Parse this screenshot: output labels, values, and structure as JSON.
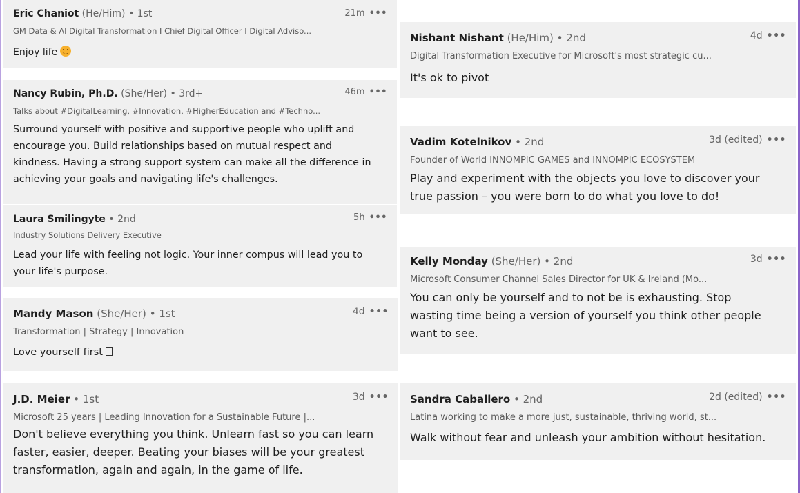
{
  "left": [
    {
      "name": "Eric Chaniot",
      "pron": "(He/Him)",
      "deg": "• 1st",
      "tagline": "GM Data & AI Digital Transformation I Chief Digital Officer I Digital Adviso...",
      "time": "21m",
      "message": "Enjoy life",
      "emoji": "smiling-face-icon"
    },
    {
      "name": "Nancy Rubin, Ph.D.",
      "pron": "(She/Her)",
      "deg": "• 3rd+",
      "tagline": "Talks about #DigitalLearning, #Innovation, #HigherEducation and #Techno...",
      "time": "46m",
      "message": [
        "Surround yourself with positive and supportive people who uplift and",
        "encourage you. Build relationships based on mutual respect and",
        "kindness. Having a strong support system can make all the difference in",
        "achieving your goals and navigating life's challenges."
      ]
    },
    {
      "name": "Laura Smilingyte",
      "pron": "",
      "deg": "• 2nd",
      "tagline": "Industry Solutions Delivery Executive",
      "time": "5h",
      "message": [
        "Lead your life with feeling not logic. Your inner compus will lead you to",
        "your life's purpose."
      ]
    },
    {
      "name": "Mandy Mason",
      "pron": "(She/Her)",
      "deg": "• 1st",
      "tagline": "Transformation | Strategy | Innovation",
      "time": "4d",
      "message": "Love yourself first"
    },
    {
      "name": "J.D. Meier",
      "pron": "",
      "deg": "• 1st",
      "tagline": "Microsoft 25 years | Leading Innovation for a Sustainable Future |...",
      "time": "3d",
      "message": [
        "Don't believe everything you think. Unlearn fast so you can learn",
        "faster, easier, deeper. Beating your biases will be your greatest",
        "transformation, again and again, in the game of life."
      ]
    }
  ],
  "right": [
    {
      "name": "Nishant Nishant",
      "pron": "(He/Him)",
      "deg": "• 2nd",
      "tagline": "Digital Transformation Executive for Microsoft's most strategic cu...",
      "time": "4d",
      "message": "It's ok to pivot"
    },
    {
      "name": "Vadim Kotelnikov",
      "pron": "",
      "deg": "• 2nd",
      "tagline": "Founder of World INNOMPIC GAMES and INNOMPIC ECOSYSTEM",
      "time": "3d (edited)",
      "message": [
        "Play and experiment with the objects you love to discover your",
        "true passion – you were born to do what you love to do!"
      ]
    },
    {
      "name": "Kelly Monday",
      "pron": "(She/Her)",
      "deg": "• 2nd",
      "tagline": "Microsoft Consumer Channel Sales Director for UK & Ireland (Mo...",
      "time": "3d",
      "message": [
        "You can only be yourself and to not be is exhausting. Stop",
        "wasting time being a version of yourself you think other people",
        "want to see."
      ]
    },
    {
      "name": "Sandra Caballero",
      "pron": "",
      "deg": "• 2nd",
      "tagline": "Latina working to make a more just, sustainable, thriving world, st...",
      "time": "2d (edited)",
      "message": "Walk without fear and unleash your ambition without hesitation."
    }
  ],
  "more_label": "•••"
}
